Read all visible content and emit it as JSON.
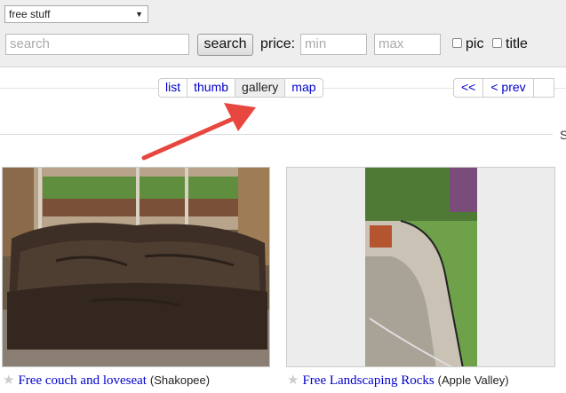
{
  "search": {
    "category": "free stuff",
    "query_placeholder": "search",
    "button_label": "search",
    "price_label": "price:",
    "min_placeholder": "min",
    "max_placeholder": "max",
    "pic_label": "pic",
    "title_label": "title"
  },
  "views": [
    {
      "label": "list",
      "active": false
    },
    {
      "label": "thumb",
      "active": false
    },
    {
      "label": "gallery",
      "active": true
    },
    {
      "label": "map",
      "active": false
    }
  ],
  "pager": {
    "first": "<<",
    "prev": "< prev"
  },
  "cutoff_text": "S",
  "listings": [
    {
      "title": "Free couch and loveseat",
      "location": "(Shakopee)",
      "image": "brown leather couch on deck"
    },
    {
      "title": "Free Landscaping Rocks",
      "location": "(Apple Valley)",
      "image": "rock garden path in yard"
    }
  ],
  "annotation": {
    "color": "#e8473f",
    "points_to": "gallery"
  },
  "icons": [
    "dropdown-arrow-icon",
    "star-icon"
  ]
}
